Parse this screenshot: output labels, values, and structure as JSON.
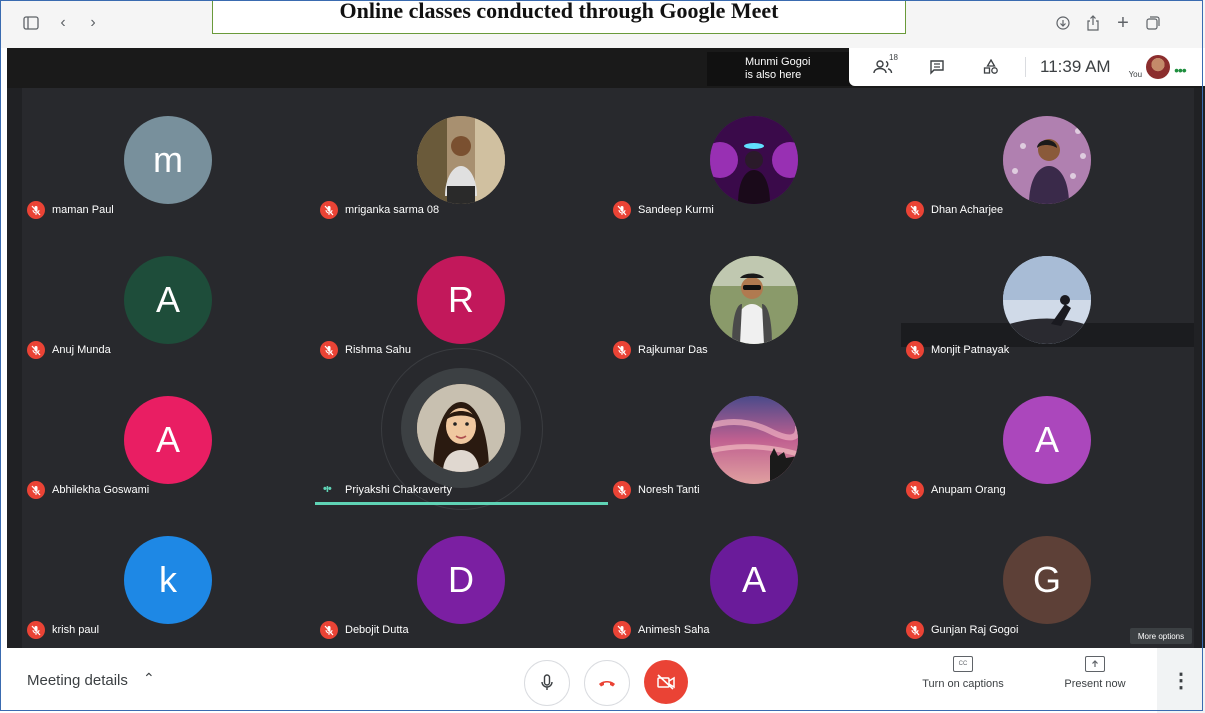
{
  "caption": "Online classes conducted through Google Meet",
  "toast": {
    "line1": "Munmi Gogoi",
    "line2": "is also here"
  },
  "top_panel": {
    "people_count": "18",
    "time": "11:39 AM",
    "you_label": "You"
  },
  "participants": [
    {
      "name": "maman Paul",
      "initial": "m",
      "color": "#78909c",
      "photo": null
    },
    {
      "name": "mriganka sarma 08",
      "initial": "",
      "color": "#8a7a5a",
      "photo": "person-outdoor"
    },
    {
      "name": "Sandeep Kurmi",
      "initial": "",
      "color": "#5b2a6e",
      "photo": "neon-room"
    },
    {
      "name": "Dhan Acharjee",
      "initial": "",
      "color": "#6a3a5a",
      "photo": "person-lights"
    },
    {
      "name": "Anuj Munda",
      "initial": "A",
      "color": "#1e4d3a",
      "photo": null
    },
    {
      "name": "Rishma Sahu",
      "initial": "R",
      "color": "#c2185b",
      "photo": null
    },
    {
      "name": "Rajkumar Das",
      "initial": "",
      "color": "#7a8a5a",
      "photo": "person-sunglasses"
    },
    {
      "name": "Monjit Patnayak",
      "initial": "",
      "color": "#4a6a8a",
      "photo": "silhouette"
    },
    {
      "name": "Abhilekha Goswami",
      "initial": "A",
      "color": "#e91e63",
      "photo": null
    },
    {
      "name": "Priyakshi Chakraverty",
      "initial": "",
      "color": "#c89a7a",
      "photo": "girl-portrait"
    },
    {
      "name": "Noresh Tanti",
      "initial": "",
      "color": "#8a5a8a",
      "photo": "sunset-sky"
    },
    {
      "name": "Anupam Orang",
      "initial": "A",
      "color": "#ab47bc",
      "photo": null
    },
    {
      "name": "krish paul",
      "initial": "k",
      "color": "#1e88e5",
      "photo": null
    },
    {
      "name": "Debojit Dutta",
      "initial": "D",
      "color": "#7b1fa2",
      "photo": null
    },
    {
      "name": "Animesh Saha",
      "initial": "A",
      "color": "#6a1b9a",
      "photo": null
    },
    {
      "name": "Gunjan Raj Gogoi",
      "initial": "G",
      "color": "#5d4037",
      "photo": null
    }
  ],
  "more_options_tooltip": "More options",
  "bottom": {
    "meeting_details": "Meeting details",
    "turn_on_captions": "Turn on captions",
    "present_now": "Present now",
    "captions_icon_text": "CC"
  }
}
